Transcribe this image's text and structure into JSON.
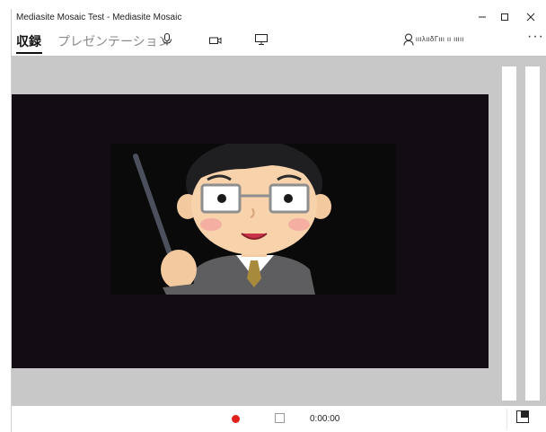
{
  "window": {
    "title": "Mediasite Mosaic Test - Mediasite Mosaic",
    "minimize_icon": "minimize-icon",
    "maximize_icon": "maximize-icon",
    "close_icon": "close-icon"
  },
  "toolbar": {
    "tabs": [
      {
        "label": "収録",
        "active": true
      },
      {
        "label": "プレゼンテーション",
        "active": false
      }
    ],
    "icons": [
      "microphone-icon",
      "camera-icon",
      "screen-icon"
    ],
    "user_icon": "user-icon",
    "user_name": "ιιιλιιδΓιιι ιι ιιιιι",
    "more_label": "···"
  },
  "video": {
    "content": "presenter-illustration"
  },
  "bottombar": {
    "record_icon": "record-icon",
    "stop_icon": "stop-icon",
    "timer": "0:00:00",
    "layout_icon": "layout-toggle-icon"
  },
  "colors": {
    "workspace": "#c8c8c8",
    "stage": "#130c14",
    "record": "#e0201a"
  }
}
